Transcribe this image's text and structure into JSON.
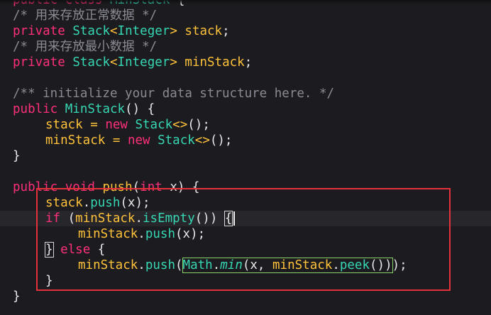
{
  "editor": {
    "lines": [
      {
        "indent": 0,
        "tokens": [
          {
            "c": "kw",
            "t": "public"
          },
          {
            "c": "pl",
            "t": " "
          },
          {
            "c": "kw",
            "t": "class"
          },
          {
            "c": "pl",
            "t": " "
          },
          {
            "c": "ty",
            "t": "MinStack"
          },
          {
            "c": "pl",
            "t": " {"
          }
        ]
      },
      {
        "indent": 0,
        "tokens": [
          {
            "c": "cm",
            "t": "/* 用来存放正常数据 */"
          }
        ]
      },
      {
        "indent": 0,
        "tokens": [
          {
            "c": "kw",
            "t": "private"
          },
          {
            "c": "pl",
            "t": " "
          },
          {
            "c": "ty",
            "t": "Stack"
          },
          {
            "c": "id",
            "t": "<"
          },
          {
            "c": "ty",
            "t": "Integer"
          },
          {
            "c": "id",
            "t": ">"
          },
          {
            "c": "pl",
            "t": " "
          },
          {
            "c": "id",
            "t": "stack"
          },
          {
            "c": "pl",
            "t": ";"
          }
        ]
      },
      {
        "indent": 0,
        "tokens": [
          {
            "c": "cm",
            "t": "/* 用来存放最小数据 */"
          }
        ]
      },
      {
        "indent": 0,
        "tokens": [
          {
            "c": "kw",
            "t": "private"
          },
          {
            "c": "pl",
            "t": " "
          },
          {
            "c": "ty",
            "t": "Stack"
          },
          {
            "c": "id",
            "t": "<"
          },
          {
            "c": "ty",
            "t": "Integer"
          },
          {
            "c": "id",
            "t": ">"
          },
          {
            "c": "pl",
            "t": " "
          },
          {
            "c": "id",
            "t": "minStack"
          },
          {
            "c": "pl",
            "t": ";"
          }
        ]
      },
      {
        "indent": 0,
        "tokens": []
      },
      {
        "indent": 0,
        "tokens": [
          {
            "c": "cm",
            "t": "/** initialize your data structure here. */"
          }
        ]
      },
      {
        "indent": 0,
        "tokens": [
          {
            "c": "kw",
            "t": "public"
          },
          {
            "c": "pl",
            "t": " "
          },
          {
            "c": "ty",
            "t": "MinStack"
          },
          {
            "c": "pl",
            "t": "() {"
          }
        ]
      },
      {
        "indent": 1,
        "tokens": [
          {
            "c": "id",
            "t": "stack"
          },
          {
            "c": "pl",
            "t": " "
          },
          {
            "c": "id",
            "t": "="
          },
          {
            "c": "pl",
            "t": " "
          },
          {
            "c": "kw",
            "t": "new"
          },
          {
            "c": "pl",
            "t": " "
          },
          {
            "c": "ty",
            "t": "Stack"
          },
          {
            "c": "id",
            "t": "<>"
          },
          {
            "c": "pl",
            "t": "();"
          }
        ]
      },
      {
        "indent": 1,
        "tokens": [
          {
            "c": "id",
            "t": "minStack"
          },
          {
            "c": "pl",
            "t": " "
          },
          {
            "c": "id",
            "t": "="
          },
          {
            "c": "pl",
            "t": " "
          },
          {
            "c": "kw",
            "t": "new"
          },
          {
            "c": "pl",
            "t": " "
          },
          {
            "c": "ty",
            "t": "Stack"
          },
          {
            "c": "id",
            "t": "<>"
          },
          {
            "c": "pl",
            "t": "();"
          }
        ]
      },
      {
        "indent": 0,
        "tokens": [
          {
            "c": "pl",
            "t": "}"
          }
        ]
      },
      {
        "indent": 0,
        "tokens": []
      },
      {
        "indent": 0,
        "tokens": [
          {
            "c": "kw",
            "t": "public"
          },
          {
            "c": "pl",
            "t": " "
          },
          {
            "c": "kw",
            "t": "void"
          },
          {
            "c": "pl",
            "t": " "
          },
          {
            "c": "id",
            "t": "push"
          },
          {
            "c": "pl",
            "t": "("
          },
          {
            "c": "kw",
            "t": "int"
          },
          {
            "c": "pl",
            "t": " x) {"
          }
        ]
      },
      {
        "indent": 1,
        "tokens": [
          {
            "c": "id",
            "t": "stack"
          },
          {
            "c": "pl",
            "t": "."
          },
          {
            "c": "ty",
            "t": "push"
          },
          {
            "c": "pl",
            "t": "(x);"
          }
        ]
      },
      {
        "indent": 1,
        "current": true,
        "tokens": [
          {
            "c": "kw",
            "t": "if"
          },
          {
            "c": "pl",
            "t": " ("
          },
          {
            "c": "id",
            "t": "minStack"
          },
          {
            "c": "pl",
            "t": "."
          },
          {
            "c": "ty",
            "t": "isEmpty"
          },
          {
            "c": "pl",
            "t": "()) "
          },
          {
            "c": "pl",
            "t": "{",
            "box": "brk"
          }
        ]
      },
      {
        "indent": 2,
        "tokens": [
          {
            "c": "id",
            "t": "minStack"
          },
          {
            "c": "pl",
            "t": "."
          },
          {
            "c": "ty",
            "t": "push"
          },
          {
            "c": "pl",
            "t": "(x);"
          }
        ]
      },
      {
        "indent": 1,
        "tokens": [
          {
            "c": "pl",
            "t": "}",
            "box": "brk"
          },
          {
            "c": "pl",
            "t": " "
          },
          {
            "c": "kw",
            "t": "else"
          },
          {
            "c": "pl",
            "t": " {"
          }
        ]
      },
      {
        "indent": 2,
        "tokens": [
          {
            "c": "id",
            "t": "minStack"
          },
          {
            "c": "pl",
            "t": "."
          },
          {
            "c": "ty",
            "t": "push"
          },
          {
            "c": "pl",
            "t": "("
          },
          {
            "c": "ty",
            "t": "Math",
            "box": "open"
          },
          {
            "c": "pl",
            "t": ".",
            "box": "mid"
          },
          {
            "c": "ty it",
            "t": "min",
            "box": "mid"
          },
          {
            "c": "pl",
            "t": "(x, ",
            "box": "mid"
          },
          {
            "c": "id",
            "t": "minStack",
            "box": "mid"
          },
          {
            "c": "pl",
            "t": ".",
            "box": "mid"
          },
          {
            "c": "ty",
            "t": "peek",
            "box": "mid"
          },
          {
            "c": "pl",
            "t": "())",
            "box": "close"
          },
          {
            "c": "pl",
            "t": ");"
          }
        ]
      },
      {
        "indent": 1,
        "tokens": [
          {
            "c": "pl",
            "t": "}"
          }
        ]
      },
      {
        "indent": 0,
        "tokens": [
          {
            "c": "pl",
            "t": "}"
          }
        ]
      }
    ]
  }
}
